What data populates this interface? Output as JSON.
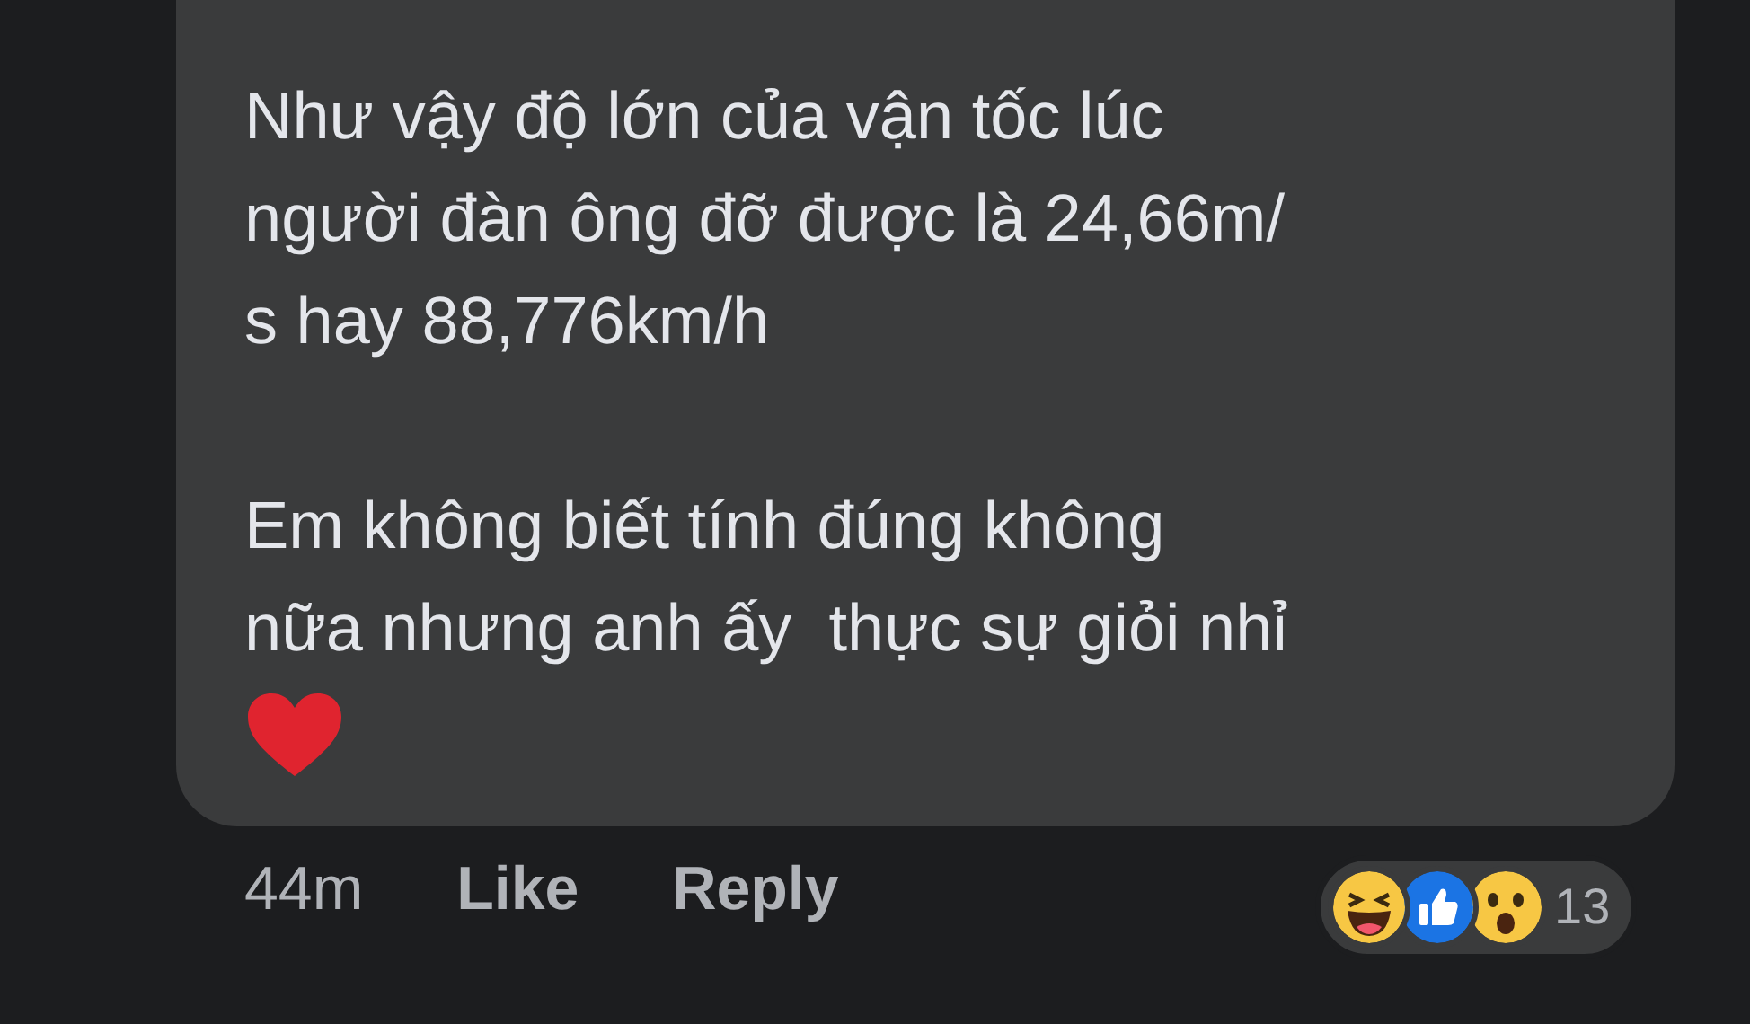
{
  "comment": {
    "paragraphs": [
      {
        "lines": [
          "Như vậy độ lớn của vận tốc lúc",
          "người đàn ông đỡ được là 24,66m/",
          "s hay 88,776km/h"
        ]
      },
      {
        "lines": [
          "Em không biết tính đúng không",
          "nữa nhưng anh ấy  thực sự giỏi nhỉ"
        ]
      }
    ]
  },
  "actions": {
    "time": "44m",
    "like": "Like",
    "reply": "Reply"
  },
  "reactions": {
    "count": "13",
    "items": [
      {
        "kind": "haha"
      },
      {
        "kind": "like"
      },
      {
        "kind": "wow"
      }
    ]
  }
}
